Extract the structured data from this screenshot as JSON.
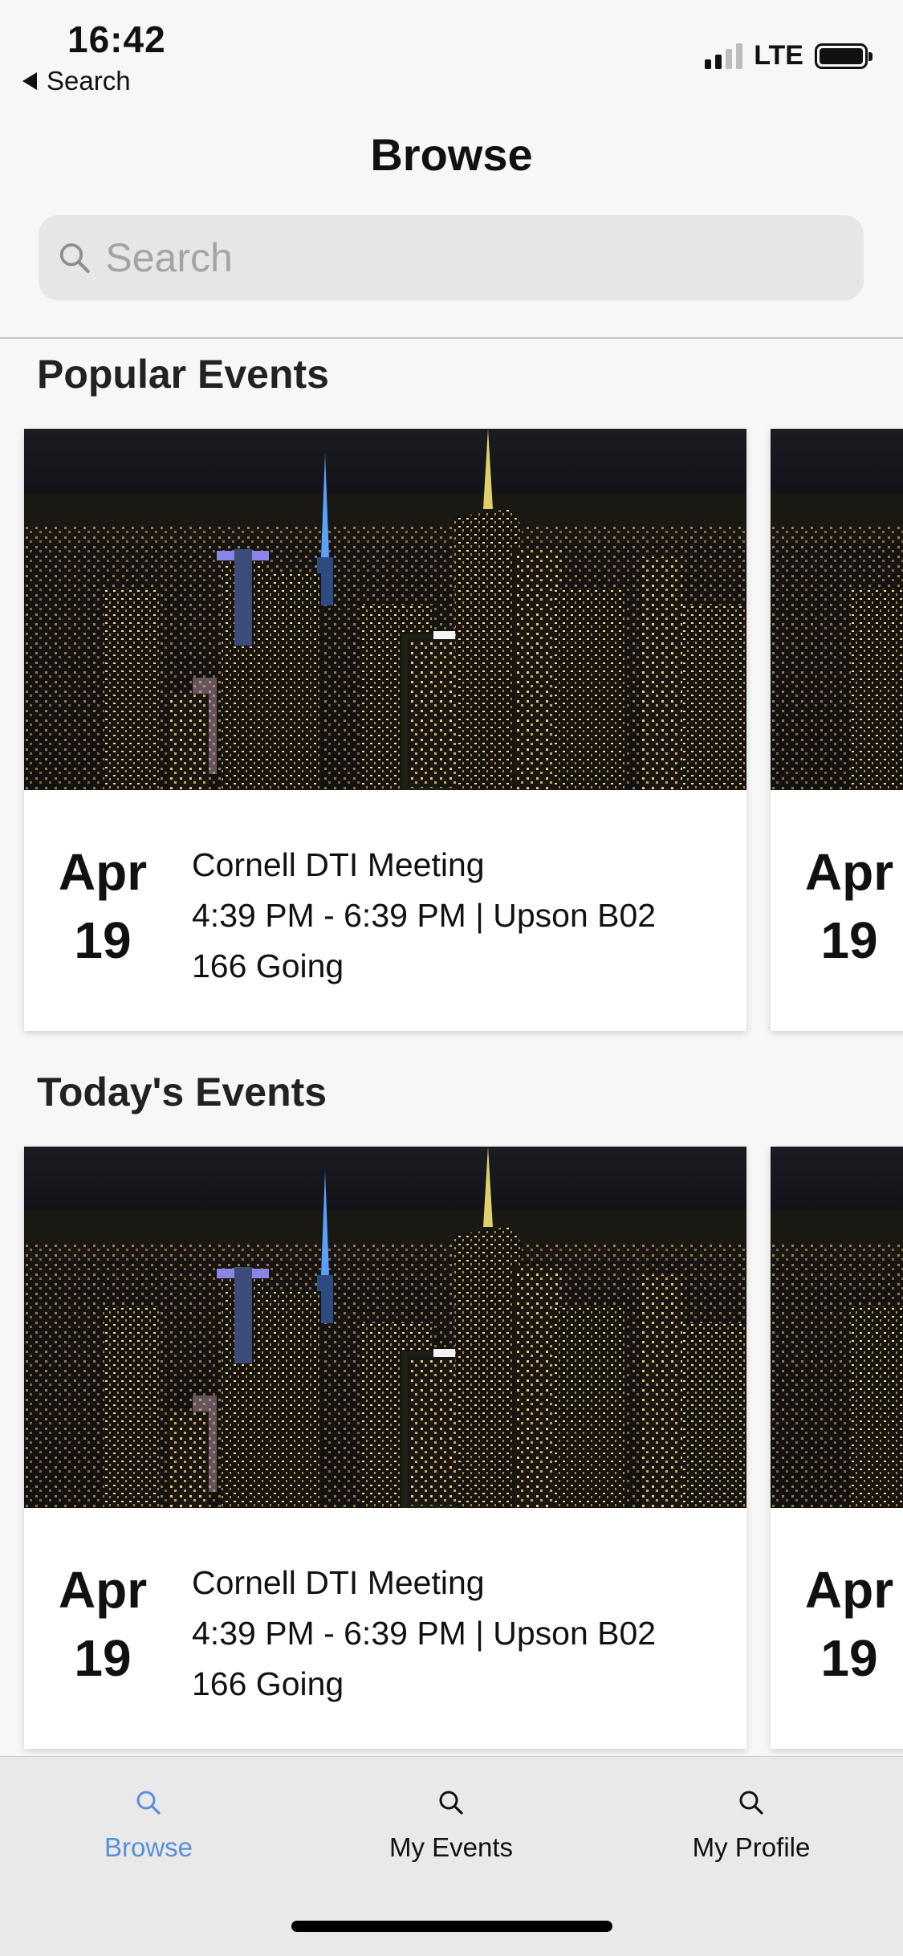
{
  "status_bar": {
    "time": "16:42",
    "back_label": "Search",
    "network": "LTE"
  },
  "header": {
    "title": "Browse"
  },
  "search": {
    "placeholder": "Search"
  },
  "sections": {
    "popular": {
      "title": "Popular Events",
      "cards": [
        {
          "month": "Apr",
          "day": "19",
          "name": "Cornell DTI Meeting",
          "time_location": "4:39 PM - 6:39 PM | Upson B02",
          "going": "166 Going"
        },
        {
          "month": "Apr",
          "day": "19"
        }
      ]
    },
    "today": {
      "title": "Today's Events",
      "cards": [
        {
          "month": "Apr",
          "day": "19",
          "name": "Cornell DTI Meeting",
          "time_location": "4:39 PM - 6:39 PM | Upson B02",
          "going": "166 Going"
        },
        {
          "month": "Apr",
          "day": "19"
        }
      ]
    }
  },
  "tab_bar": {
    "active_color": "#5a8fd8",
    "tabs": [
      {
        "label": "Browse",
        "icon": "search-icon"
      },
      {
        "label": "My Events",
        "icon": "search-icon"
      },
      {
        "label": "My Profile",
        "icon": "search-icon"
      }
    ]
  }
}
